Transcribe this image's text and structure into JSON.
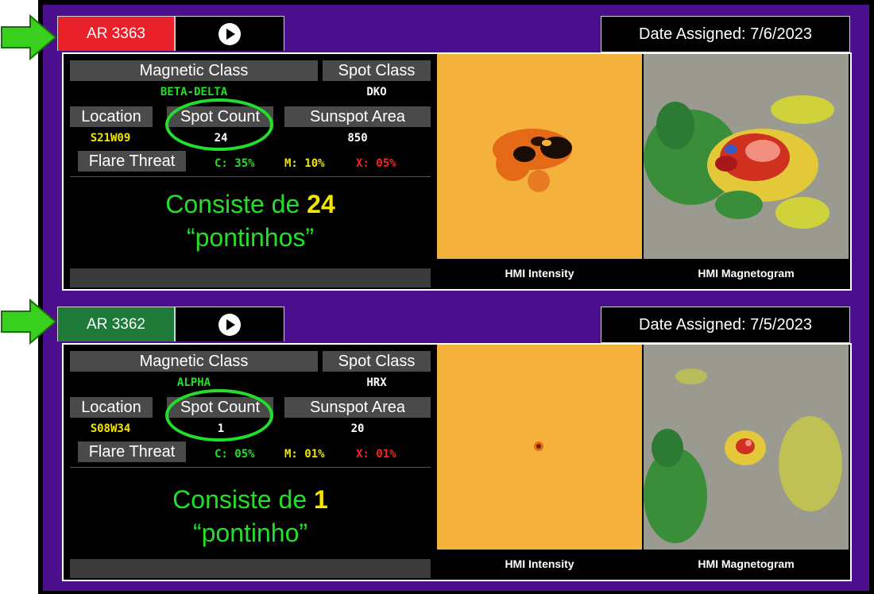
{
  "regions": [
    {
      "ar_label": "AR 3363",
      "ar_color": "#e8212a",
      "date_assigned": "Date Assigned: 7/6/2023",
      "magnetic_class_header": "Magnetic Class",
      "magnetic_class": "BETA-DELTA",
      "spot_class_header": "Spot Class",
      "spot_class": "DKO",
      "location_header": "Location",
      "location": "S21W09",
      "spot_count_header": "Spot Count",
      "spot_count": "24",
      "sunspot_area_header": "Sunspot Area",
      "sunspot_area": "850",
      "flare_threat_header": "Flare Threat",
      "flare_c": "C: 35%",
      "flare_m": "M: 10%",
      "flare_x": "X: 05%",
      "overlay_prefix": "Consiste de ",
      "overlay_number": "24",
      "overlay_word": "“pontinhos”",
      "caption_intensity": "HMI Intensity",
      "caption_magnetogram": "HMI Magnetogram"
    },
    {
      "ar_label": "AR 3362",
      "ar_color": "#1f7a3a",
      "date_assigned": "Date Assigned: 7/5/2023",
      "magnetic_class_header": "Magnetic Class",
      "magnetic_class": "ALPHA",
      "spot_class_header": "Spot Class",
      "spot_class": "HRX",
      "location_header": "Location",
      "location": "S08W34",
      "spot_count_header": "Spot Count",
      "spot_count": "1",
      "sunspot_area_header": "Sunspot Area",
      "sunspot_area": "20",
      "flare_threat_header": "Flare Threat",
      "flare_c": "C: 05%",
      "flare_m": "M: 01%",
      "flare_x": "X: 01%",
      "overlay_prefix": "Consiste de ",
      "overlay_number": "1",
      "overlay_word": "“pontinho”",
      "caption_intensity": "HMI Intensity",
      "caption_magnetogram": "HMI Magnetogram"
    }
  ],
  "icons": {
    "play": "play-icon",
    "pointer": "arrow-icon"
  }
}
